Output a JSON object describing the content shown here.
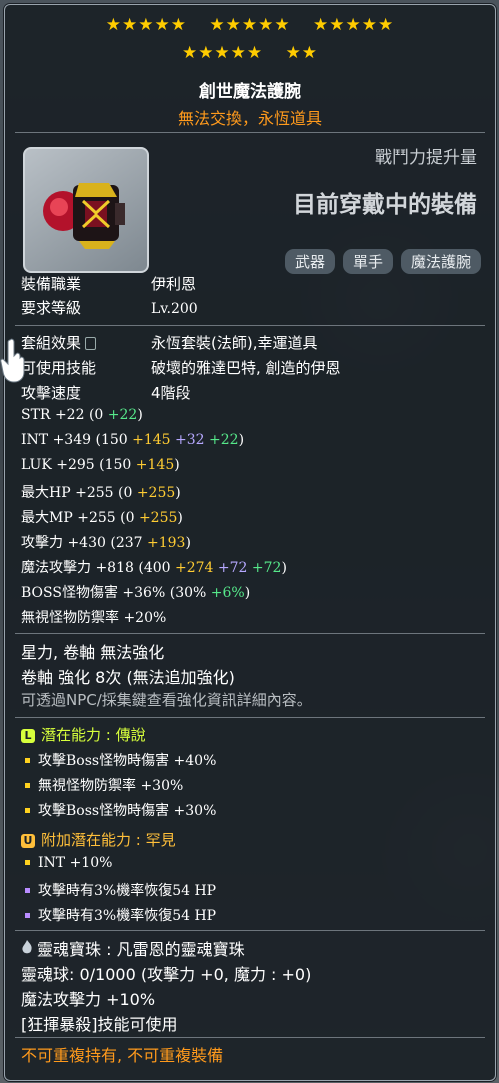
{
  "stars": {
    "row1": [
      "★★★★★",
      "★★★★★",
      "★★★★★"
    ],
    "row2": [
      "★★★★★",
      "★★"
    ]
  },
  "item": {
    "name": "創世魔法護腕",
    "subtitle": "無法交換，永恆道具"
  },
  "power_label": "戰鬥力提升量",
  "wearing_label": "目前穿戴中的裝備",
  "tags": [
    "武器",
    "單手",
    "魔法護腕"
  ],
  "req": [
    {
      "k": "裝備職業",
      "v": "伊利恩"
    },
    {
      "k": "要求等級",
      "v": "Lv.200"
    }
  ],
  "info": [
    {
      "k": "套組效果",
      "v": "永恆套裝(法師),幸運道具"
    },
    {
      "k": "可使用技能",
      "v": "破壞的雅達巴特, 創造的伊恩"
    },
    {
      "k": "攻擊速度",
      "v": "4階段"
    }
  ],
  "stats": [
    {
      "k": "STR",
      "total": "+22",
      "open": "(0",
      "parts": [
        {
          "v": "+22",
          "c": "g"
        }
      ],
      "close": ")"
    },
    {
      "k": "INT",
      "total": "+349",
      "open": "(150",
      "parts": [
        {
          "v": "+145",
          "c": "y"
        },
        {
          "v": "+32",
          "c": "p"
        },
        {
          "v": "+22",
          "c": "g"
        }
      ],
      "close": ")"
    },
    {
      "k": "LUK",
      "total": "+295",
      "open": "(150",
      "parts": [
        {
          "v": "+145",
          "c": "y"
        }
      ],
      "close": ")"
    },
    {
      "k": "最大HP",
      "total": "+255",
      "open": "(0",
      "parts": [
        {
          "v": "+255",
          "c": "y"
        }
      ],
      "close": ")"
    },
    {
      "k": "最大MP",
      "total": "+255",
      "open": "(0",
      "parts": [
        {
          "v": "+255",
          "c": "y"
        }
      ],
      "close": ")"
    },
    {
      "k": "攻擊力",
      "total": "+430",
      "open": "(237",
      "parts": [
        {
          "v": "+193",
          "c": "y"
        }
      ],
      "close": ")"
    },
    {
      "k": "魔法攻擊力",
      "total": "+818",
      "open": "(400",
      "parts": [
        {
          "v": "+274",
          "c": "y"
        },
        {
          "v": "+72",
          "c": "p"
        },
        {
          "v": "+72",
          "c": "g"
        }
      ],
      "close": ")"
    },
    {
      "k": "BOSS怪物傷害",
      "total": "+36%",
      "open": "(30%",
      "parts": [
        {
          "v": "+6%",
          "c": "g"
        }
      ],
      "close": ")"
    },
    {
      "k": "無視怪物防禦率",
      "total": "+20%",
      "open": "",
      "parts": [],
      "close": ""
    }
  ],
  "enhance": [
    "星力, 卷軸 無法強化",
    "卷軸 強化 8次 (無法追加強化)",
    "可透過NPC/採集鍵查看強化資訊詳細內容。"
  ],
  "potential": {
    "icon": "L",
    "color": "#d7ff3c",
    "title": "潛在能力 : 傳說",
    "lines": [
      {
        "text": "攻擊Boss怪物時傷害 +40%",
        "bullet": "#ffd21f"
      },
      {
        "text": "無視怪物防禦率 +30%",
        "bullet": "#ffd21f"
      },
      {
        "text": "攻擊Boss怪物時傷害 +30%",
        "bullet": "#ffd21f"
      }
    ]
  },
  "additional": {
    "icon": "U",
    "color": "#ffbf3a",
    "title": "附加潛在能力 : 罕見",
    "lines": [
      {
        "text": "INT +10%",
        "bullet": "#ffd21f"
      },
      {
        "text": "攻擊時有3%機率恢復54 HP",
        "bullet": "#b98cff"
      },
      {
        "text": "攻擊時有3%機率恢復54 HP",
        "bullet": "#b98cff"
      }
    ]
  },
  "soul": {
    "title": "靈魂寶珠 : 凡雷恩的靈魂寶珠",
    "line1": "靈魂球: 0/1000 (攻擊力 +0, 魔力 : +0)",
    "line2": "魔法攻擊力 +10%",
    "line3": "[狂揮暴殺]技能可使用"
  },
  "footer": "不可重複持有, 不可重複裝備",
  "colors": {
    "accent": "#ff9a1c",
    "star": "#ffcc00",
    "bonus_yellow": "#ffcc33",
    "bonus_purple": "#b6a8ff",
    "bonus_green": "#56e88a"
  }
}
